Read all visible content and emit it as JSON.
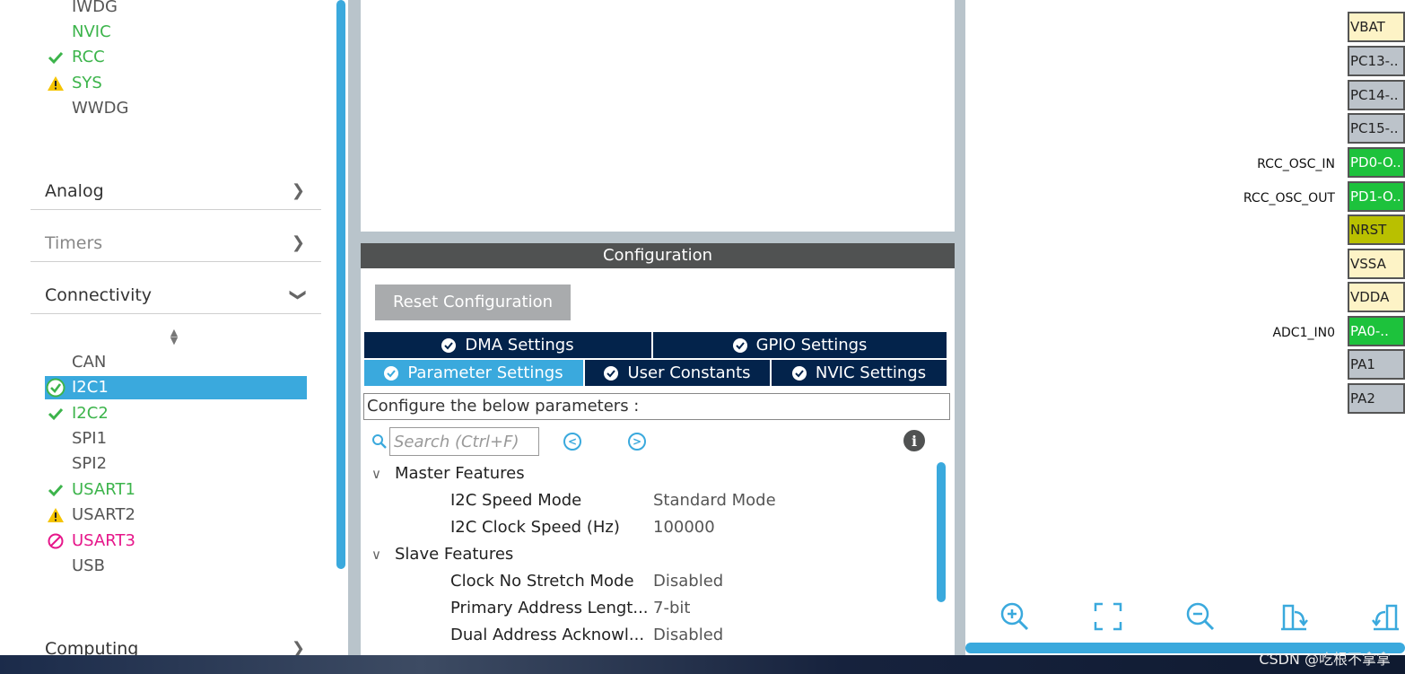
{
  "sidebar": {
    "top_items": [
      {
        "label": "IWDG",
        "status": "none",
        "color": "#555555"
      },
      {
        "label": "NVIC",
        "status": "none",
        "color": "#3cb44b"
      },
      {
        "label": "RCC",
        "status": "check",
        "color": "#3cb44b"
      },
      {
        "label": "SYS",
        "status": "warning",
        "color": "#3cb44b"
      },
      {
        "label": "WWDG",
        "status": "none",
        "color": "#555555"
      }
    ],
    "categories": {
      "analog": "Analog",
      "timers": "Timers",
      "connectivity": "Connectivity",
      "computing": "Computing"
    },
    "connectivity_items": [
      {
        "label": "CAN",
        "status": "none"
      },
      {
        "label": "I2C1",
        "status": "check-circle",
        "selected": true
      },
      {
        "label": "I2C2",
        "status": "check"
      },
      {
        "label": "SPI1",
        "status": "none"
      },
      {
        "label": "SPI2",
        "status": "none"
      },
      {
        "label": "USART1",
        "status": "check"
      },
      {
        "label": "USART2",
        "status": "warning"
      },
      {
        "label": "USART3",
        "status": "disabled"
      },
      {
        "label": "USB",
        "status": "none"
      }
    ]
  },
  "config": {
    "header": "Configuration",
    "reset_label": "Reset Configuration",
    "tabs": {
      "dma": "DMA Settings",
      "gpio": "GPIO Settings",
      "parameter": "Parameter Settings",
      "user_constants": "User Constants",
      "nvic": "NVIC Settings"
    },
    "hint": "Configure the below parameters :",
    "search_placeholder": "Search (Ctrl+F)",
    "groups": {
      "master": "Master Features",
      "slave": "Slave Features"
    },
    "params": {
      "speed_mode": {
        "name": "I2C Speed Mode",
        "value": "Standard Mode"
      },
      "clock_speed": {
        "name": "I2C Clock Speed (Hz)",
        "value": "100000"
      },
      "no_stretch": {
        "name": "Clock No Stretch Mode",
        "value": "Disabled"
      },
      "addr_length": {
        "name": "Primary Address Lengt...",
        "value": "7-bit"
      },
      "dual_addr": {
        "name": "Dual Address Acknowl...",
        "value": "Disabled"
      }
    }
  },
  "pinout": {
    "pins": [
      {
        "name": "VBAT",
        "color": "#fdf3c6",
        "label": ""
      },
      {
        "name": "PC13-..",
        "color": "#bcc3ca",
        "label": ""
      },
      {
        "name": "PC14-..",
        "color": "#bcc3ca",
        "label": ""
      },
      {
        "name": "PC15-..",
        "color": "#bcc3ca",
        "label": ""
      },
      {
        "name": "PD0-O..",
        "color": "#1dc23c",
        "label": "RCC_OSC_IN"
      },
      {
        "name": "PD1-O..",
        "color": "#1dc23c",
        "label": "RCC_OSC_OUT"
      },
      {
        "name": "NRST",
        "color": "#b9c000",
        "label": ""
      },
      {
        "name": "VSSA",
        "color": "#fdf3c6",
        "label": ""
      },
      {
        "name": "VDDA",
        "color": "#fdf3c6",
        "label": ""
      },
      {
        "name": "PA0-..",
        "color": "#1dc23c",
        "label": "ADC1_IN0"
      },
      {
        "name": "PA1",
        "color": "#bcc3ca",
        "label": ""
      },
      {
        "name": "PA2",
        "color": "#bcc3ca",
        "label": ""
      }
    ]
  },
  "watermark": "CSDN @吃根不拿拿"
}
